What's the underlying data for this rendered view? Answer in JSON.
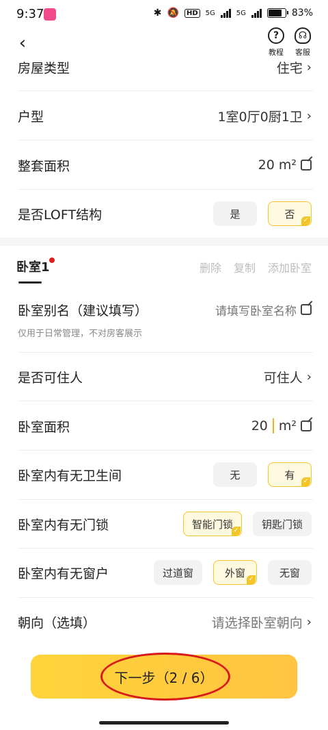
{
  "status_bar": {
    "time": "9:37",
    "hd": "HD",
    "net1": "5G",
    "net2": "5G",
    "battery": "83%"
  },
  "header": {
    "help_label": "教程",
    "service_label": "客服"
  },
  "house": {
    "type_label": "房屋类型",
    "type_value": "住宅",
    "layout_label": "户型",
    "layout_value": "1室0厅0厨1卫",
    "area_label": "整套面积",
    "area_value": "20 m²",
    "loft_label": "是否LOFT结构",
    "loft_yes": "是",
    "loft_no": "否",
    "loft_selected": "否"
  },
  "bedroom_tabs": {
    "active": "卧室1",
    "delete": "删除",
    "copy": "复制",
    "add": "添加卧室"
  },
  "bedroom": {
    "alias_label": "卧室别名（建议填写）",
    "alias_placeholder": "请填写卧室名称",
    "alias_note": "仅用于日常管理，不对房客展示",
    "livable_label": "是否可住人",
    "livable_value": "可住人",
    "area_label": "卧室面积",
    "area_value": "20",
    "area_unit": "m²",
    "bath_label": "卧室内有无卫生间",
    "bath_none": "无",
    "bath_has": "有",
    "bath_selected": "有",
    "lock_label": "卧室内有无门锁",
    "lock_smart": "智能门锁",
    "lock_key": "钥匙门锁",
    "lock_selected": "智能门锁",
    "window_label": "卧室内有无窗户",
    "window_aisle": "过道窗",
    "window_outer": "外窗",
    "window_none": "无窗",
    "window_selected": "外窗",
    "orient_label": "朝向（选填）",
    "orient_placeholder": "请选择卧室朝向"
  },
  "footer": {
    "next_label": "下一步（2 / 6）"
  },
  "colors": {
    "accent": "#ffc93a",
    "selected_border": "#f3c52a",
    "annotation": "#d91a1a"
  }
}
